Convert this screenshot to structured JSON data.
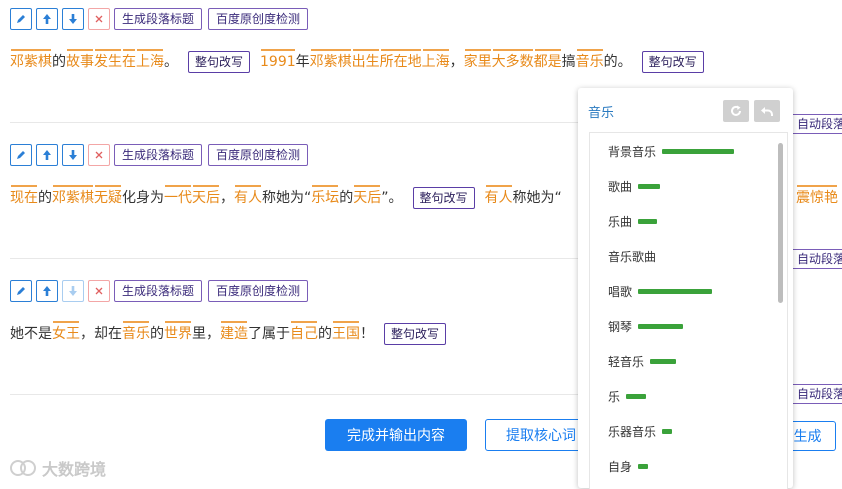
{
  "toolbar": {
    "btn_title": "生成段落标题",
    "btn_check": "百度原创度检测"
  },
  "rewrite_label": "整句改写",
  "auto_segment_label": "自动段落",
  "para1": [
    {
      "t": "邓紫棋",
      "k": true
    },
    {
      "t": "的",
      "k": false
    },
    {
      "t": "故事",
      "k": true
    },
    {
      "t": "发生",
      "k": true
    },
    {
      "t": "在",
      "k": true
    },
    {
      "t": "上海",
      "k": true
    },
    {
      "t": "。",
      "k": false
    },
    {
      "rw": true
    },
    {
      "t": "1991",
      "k": true
    },
    {
      "t": "年",
      "k": false
    },
    {
      "t": "邓紫棋",
      "k": true
    },
    {
      "t": "出生",
      "k": true
    },
    {
      "t": "所在地",
      "k": true
    },
    {
      "t": "上海",
      "k": true
    },
    {
      "t": "，",
      "k": false
    },
    {
      "t": "家里",
      "k": true
    },
    {
      "t": "大多数",
      "k": true
    },
    {
      "t": "都是",
      "k": true
    },
    {
      "t": "搞",
      "k": false
    },
    {
      "t": "音乐",
      "k": true
    },
    {
      "t": "的。",
      "k": false
    },
    {
      "rw": true
    }
  ],
  "para2": [
    {
      "t": "现在",
      "k": true
    },
    {
      "t": "的",
      "k": false
    },
    {
      "t": "邓紫棋",
      "k": true
    },
    {
      "t": "无疑",
      "k": true
    },
    {
      "t": "化身为",
      "k": false
    },
    {
      "t": "一代",
      "k": true
    },
    {
      "t": "天后",
      "k": true
    },
    {
      "t": "，",
      "k": false
    },
    {
      "t": "有人",
      "k": true
    },
    {
      "t": "称她为“",
      "k": false
    },
    {
      "t": "乐坛",
      "k": true
    },
    {
      "t": "的",
      "k": false
    },
    {
      "t": "天后",
      "k": true
    },
    {
      "t": "”。",
      "k": false
    },
    {
      "rw": true
    },
    {
      "t": "有人",
      "k": true
    },
    {
      "t": "称她为“",
      "k": false
    }
  ],
  "para2_tail": "震惊艳",
  "para3": [
    {
      "t": "她不是",
      "k": false
    },
    {
      "t": "女王",
      "k": true
    },
    {
      "t": "，却在",
      "k": false
    },
    {
      "t": "音乐",
      "k": true
    },
    {
      "t": "的",
      "k": false
    },
    {
      "t": "世界",
      "k": true
    },
    {
      "t": "里，",
      "k": false
    },
    {
      "t": "建造",
      "k": true
    },
    {
      "t": "了属于",
      "k": false
    },
    {
      "t": "自己",
      "k": true
    },
    {
      "t": "的",
      "k": false
    },
    {
      "t": "王国",
      "k": true
    },
    {
      "t": "！",
      "k": false
    },
    {
      "rw": true
    }
  ],
  "bottom": {
    "finish": "完成并输出内容",
    "extract": "提取核心词",
    "generate": "生成"
  },
  "watermark": "大数跨境",
  "dropdown": {
    "header": "音乐",
    "items": [
      {
        "label": "背景音乐",
        "score": 0.72
      },
      {
        "label": "歌曲",
        "score": 0.22
      },
      {
        "label": "乐曲",
        "score": 0.19
      },
      {
        "label": "音乐歌曲",
        "score": 0
      },
      {
        "label": "唱歌",
        "score": 0.74
      },
      {
        "label": "钢琴",
        "score": 0.45
      },
      {
        "label": "轻音乐",
        "score": 0.26
      },
      {
        "label": "乐",
        "score": 0.2
      },
      {
        "label": "乐器音乐",
        "score": 0.1
      },
      {
        "label": "自身",
        "score": 0.1
      }
    ]
  }
}
